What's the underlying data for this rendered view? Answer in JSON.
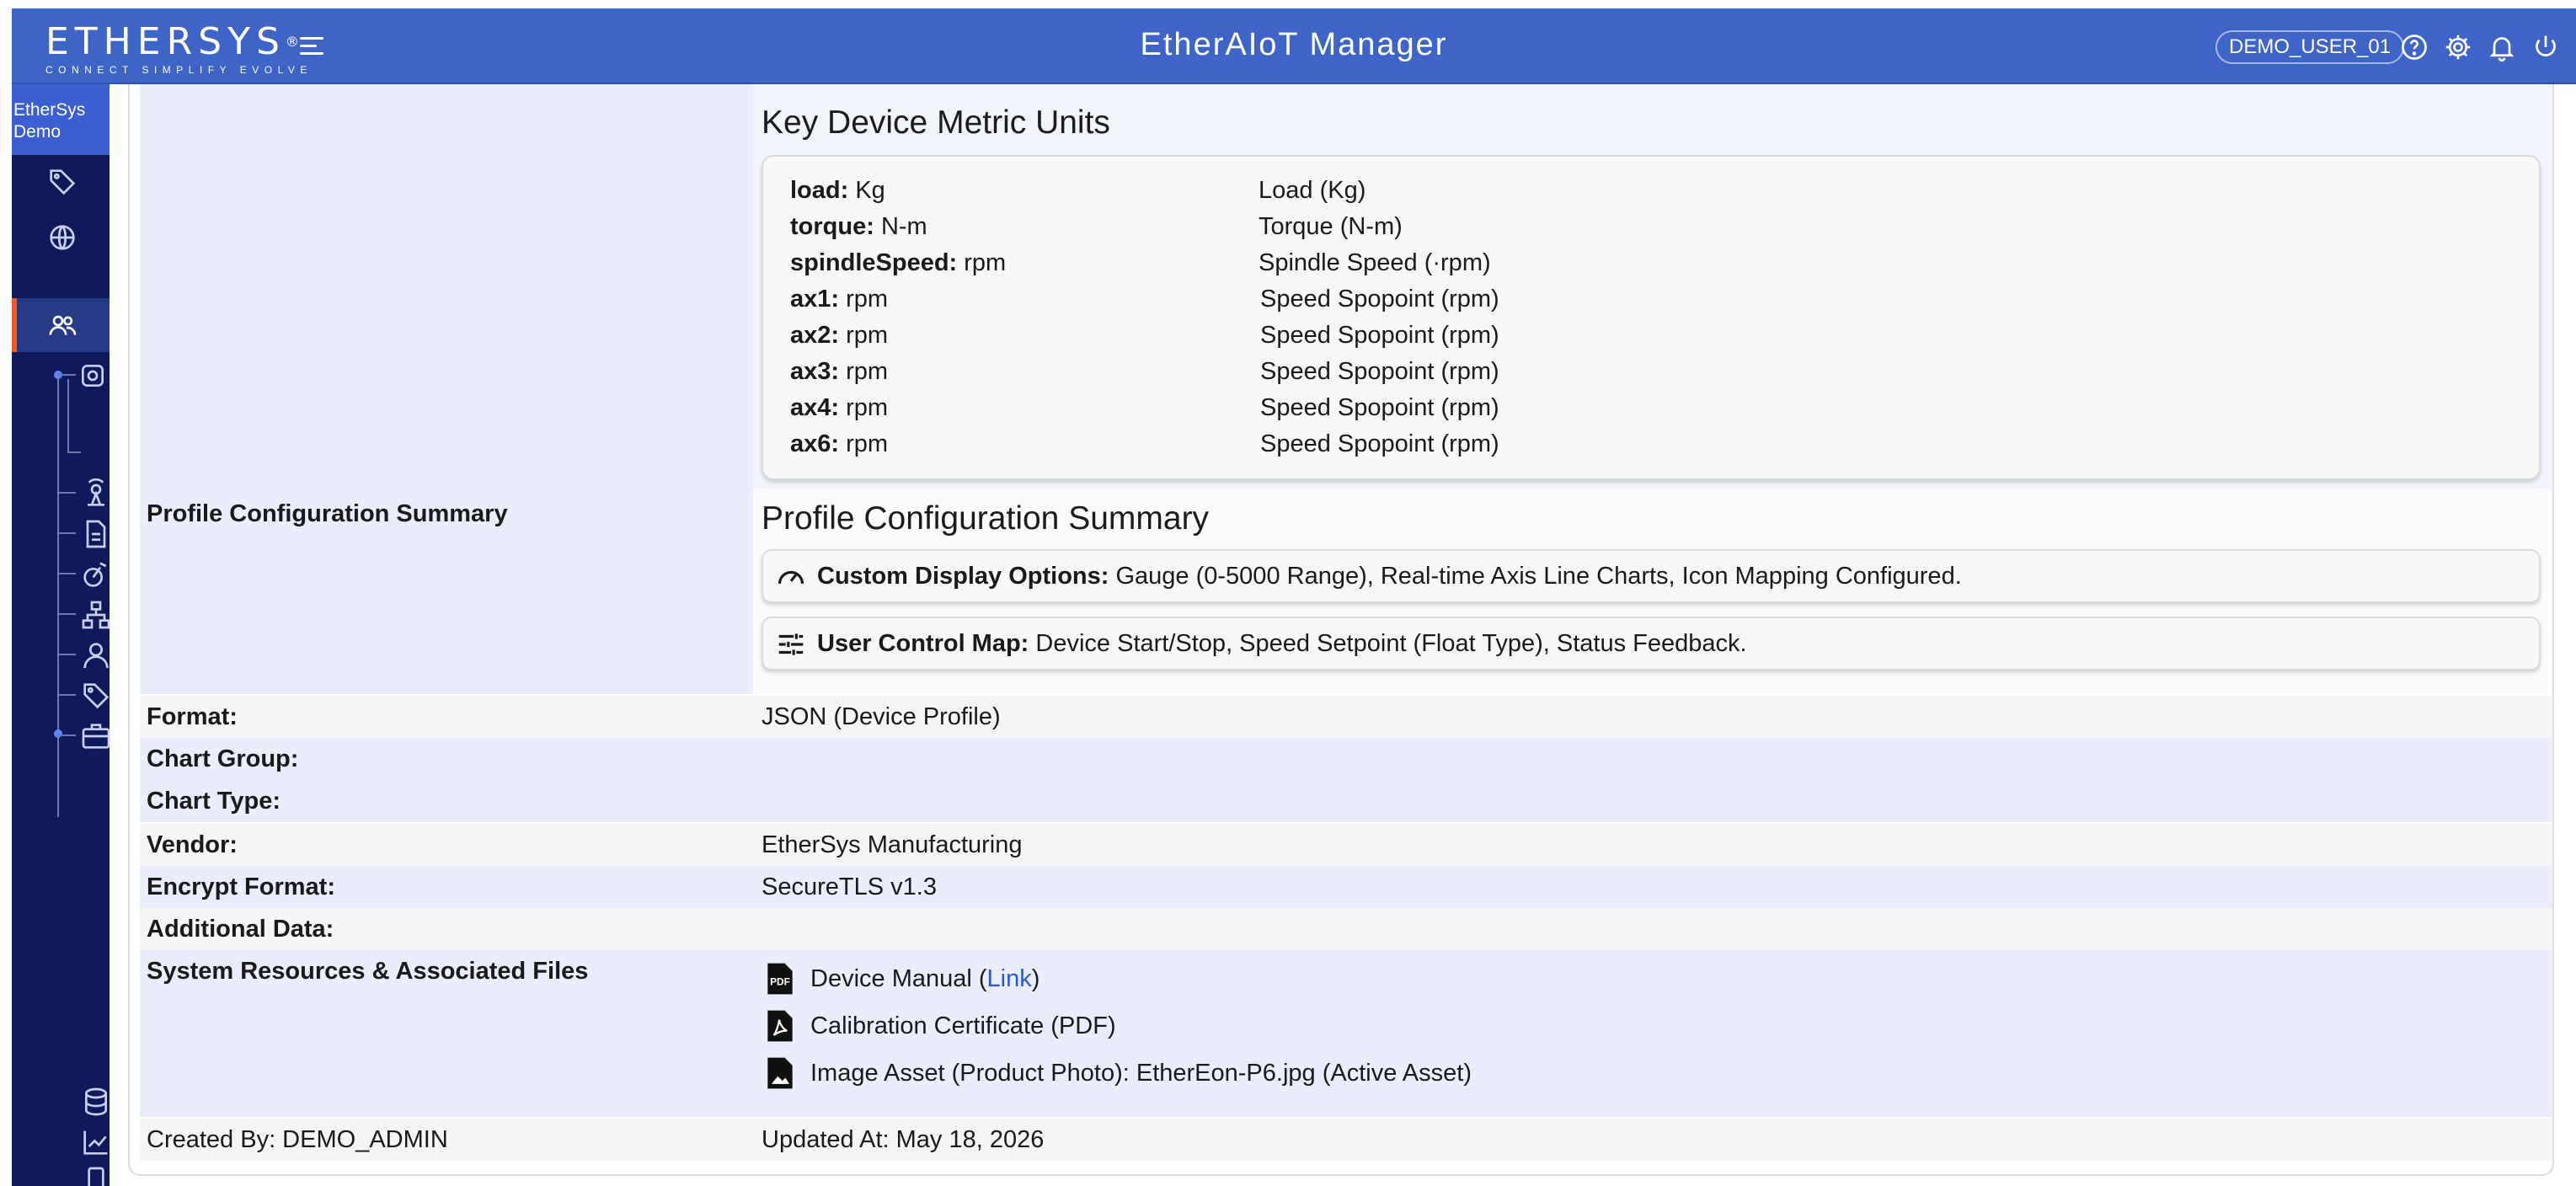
{
  "header": {
    "logo_text": "ETHERSYS",
    "logo_reg": "®",
    "logo_tagline": "CONNECT SIMPLIFY EVOLVE",
    "app_title": "EtherAIoT Manager",
    "user": "DEMO_USER_01",
    "icons": [
      "help-icon",
      "gear-icon",
      "bell-icon",
      "power-icon"
    ],
    "accent_color": "#3f64c8"
  },
  "sidebar": {
    "org_label": "EtherSys Demo",
    "active_accent": "#f05a28",
    "icons": [
      "dashboard-icon",
      "tag-icon",
      "globe-icon",
      "users-icon",
      "camera-icon",
      "station-icon",
      "document-icon",
      "gauge-icon",
      "hierarchy-icon",
      "person-icon",
      "tags-icon",
      "briefcase-icon",
      "database-icon",
      "chart-icon",
      "device-icon"
    ]
  },
  "metrics": {
    "title": "Key Device Metric Units",
    "rows": [
      {
        "key": "load:",
        "unit": "Kg",
        "desc": "Load (Kg)"
      },
      {
        "key": "torque:",
        "unit": "N-m",
        "desc": "Torque (N-m)"
      },
      {
        "key": "spindleSpeed:",
        "unit": "rpm",
        "desc": "Spindle Speed (·rpm)"
      },
      {
        "key": "ax1:",
        "unit": "rpm",
        "desc": "Speed Spopoint (rpm)"
      },
      {
        "key": "ax2:",
        "unit": "rpm",
        "desc": "Speed Spopoint (rpm)"
      },
      {
        "key": "ax3:",
        "unit": "rpm",
        "desc": "Speed Spopoint (rpm)"
      },
      {
        "key": "ax4:",
        "unit": "rpm",
        "desc": "Speed Spopoint (rpm)"
      },
      {
        "key": "ax6:",
        "unit": "rpm",
        "desc": "Speed Spopoint (rpm)"
      }
    ]
  },
  "profile": {
    "label": "Profile Configuration Summary",
    "title": "Profile Configuration Summary",
    "display_options_label": "Custom Display Options:",
    "display_options_value": "Gauge (0-5000 Range), Real-time Axis Line Charts, Icon Mapping Configured.",
    "control_map_label": "User Control Map:",
    "control_map_value": "Device Start/Stop, Speed Setpoint (Float Type), Status Feedback."
  },
  "fields": {
    "format_label": "Format:",
    "format_value": "JSON (Device Profile)",
    "chart_group_label": "Chart Group:",
    "chart_type_label": "Chart Type:",
    "vendor_label": "Vendor:",
    "vendor_value": "EtherSys Manufacturing",
    "encrypt_label": "Encrypt Format:",
    "encrypt_value": "SecureTLS v1.3",
    "additional_label": "Additional Data:"
  },
  "resources": {
    "label": "System Resources & Associated Files",
    "manual_text": "Device Manual (",
    "manual_link": "Link",
    "manual_close": ")",
    "calibration": "Calibration Certificate (PDF)",
    "image_asset": "Image Asset (Product Photo): EtherEon-P6.jpg (Active Asset)"
  },
  "footer": {
    "created_by": "Created By: DEMO_ADMIN",
    "updated_at": "Updated At: May 18, 2026"
  }
}
